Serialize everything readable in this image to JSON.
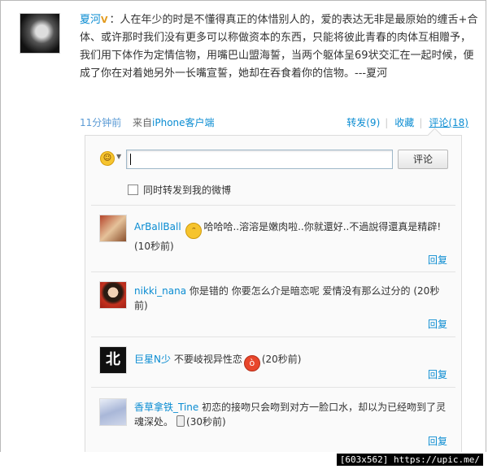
{
  "post": {
    "author": "夏河",
    "verified_badge": "V",
    "text": "人在年少的时是不懂得真正的体惜别人的，爱的表达无非是最原始的缠舌+合体、或许那时我们没有更多可以称做资本的东西，只能将彼此青春的肉体互相赠予，我们用下体作为定情信物，用嘴巴山盟海誓，当两个躯体呈69状交汇在一起时候，便成了你在对着她另外一长嘴宣誓，她却在吞食着你的信物。---夏河",
    "time": "11分钟前",
    "source_prefix": "来自",
    "source": "iPhone客户端",
    "actions": {
      "forward": "转发(9)",
      "favorite": "收藏",
      "comment": "评论(18)"
    }
  },
  "comment_box": {
    "submit_label": "评论",
    "checkbox_label": "同时转发到我的微博",
    "input_value": ""
  },
  "comments": [
    {
      "user": "ArBallBall",
      "text_after_emoji": "哈哈哈..溶溶是嫩肉啦..你就還好..不過說得還真是精辟! (10秒前)",
      "reply": "回复"
    },
    {
      "user": "nikki_nana",
      "text": "你是错的  你要怎么介是暗恋呢  爱情没有那么过分的 (20秒前)",
      "reply": "回复"
    },
    {
      "user": "巨星N少",
      "text_before_emoji": "不要岐视异性恋",
      "time": "(20秒前)",
      "reply": "回复"
    },
    {
      "user": "香草拿铁_Tine",
      "text": "初恋的接吻只会吻到对方一脸口水，却以为已经吻到了灵魂深处。",
      "time": "(30秒前)",
      "reply": "回复"
    }
  ],
  "avatar_3_glyph": "北",
  "watermark": "[603x562] https://upic.me/"
}
